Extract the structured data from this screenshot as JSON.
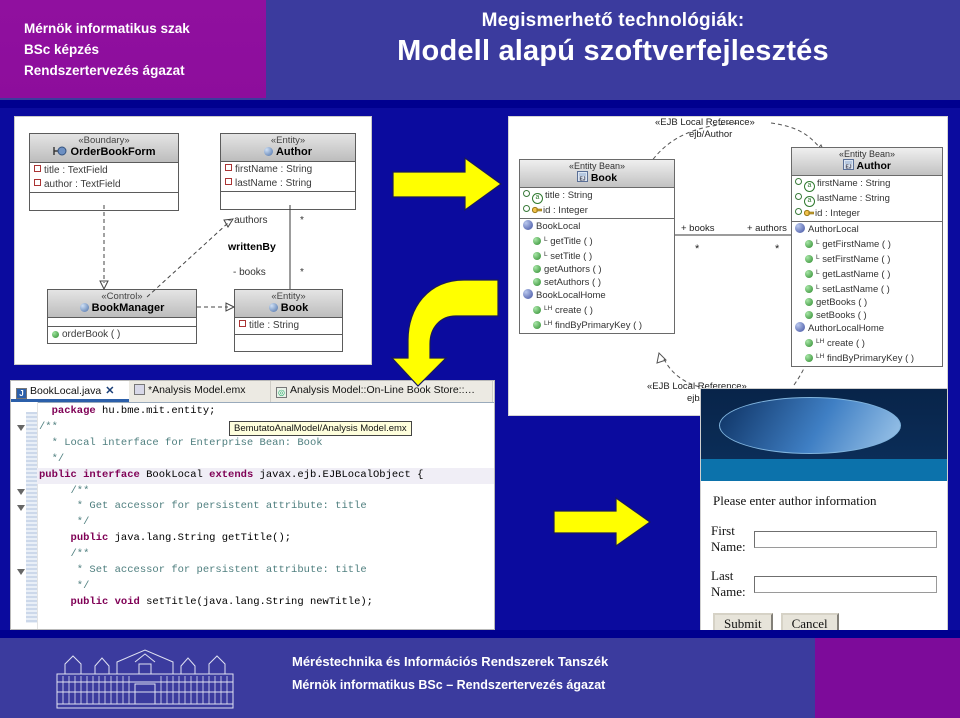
{
  "header": {
    "purple_lines": [
      "Mérnök informatikus szak",
      "BSc képzés",
      "Rendszertervezés ágazat"
    ],
    "subtitle": "Megismerhető technológiák:",
    "title": "Modell alapú szoftverfejlesztés",
    "purple_color": "#8f0f9e",
    "band_color": "#3b3b9e"
  },
  "uml_diagram": {
    "classes": [
      {
        "stereotype": "«Boundary»",
        "name": "OrderBookForm",
        "attributes": [
          "title : TextField",
          "author : TextField"
        ],
        "operations": []
      },
      {
        "stereotype": "«Entity»",
        "name": "Author",
        "attributes": [
          "firstName : String",
          "lastName : String"
        ],
        "operations": []
      },
      {
        "stereotype": "«Control»",
        "name": "BookManager",
        "attributes": [],
        "operations": [
          "orderBook ( )"
        ]
      },
      {
        "stereotype": "«Entity»",
        "name": "Book",
        "attributes": [
          "title : String"
        ],
        "operations": []
      }
    ],
    "association_name": "writtenBy",
    "role_authors": "- authors",
    "role_books": "- books",
    "mult_top": "*",
    "mult_bottom": "*"
  },
  "ejb_diagram": {
    "ref_top_stereotype": "«EJB Local Reference»",
    "ref_top_name": "ejb/Author",
    "ref_bottom_stereotype": "«EJB Local Reference»",
    "ref_bottom_name": "ejb/",
    "book": {
      "stereotype": "«Entity Bean»",
      "name": "Book",
      "attributes": [
        "title : String",
        "id : Integer"
      ],
      "local_interface": "BookLocal",
      "local_methods": [
        "getTitle ( )",
        "setTitle ( )",
        "getAuthors ( )",
        "setAuthors ( )"
      ],
      "home_interface": "BookLocalHome",
      "home_methods": [
        "create ( )",
        "findByPrimaryKey ( )"
      ]
    },
    "author": {
      "stereotype": "«Entity Bean»",
      "name": "Author",
      "attributes": [
        "firstName : String",
        "lastName : String",
        "id : Integer"
      ],
      "local_interface": "AuthorLocal",
      "local_methods": [
        "getFirstName ( )",
        "setFirstName ( )",
        "getLastName ( )",
        "setLastName ( )",
        "getBooks ( )",
        "setBooks ( )"
      ],
      "home_interface": "AuthorLocalHome",
      "home_methods": [
        "create ( )",
        "findByPrimaryKey ( )"
      ]
    },
    "role_books": "+ books",
    "role_authors": "+ authors",
    "mult_left": "*",
    "mult_right": "*"
  },
  "code_editor": {
    "tabs": [
      {
        "label": "BookLocal.java",
        "icon": "java-file-icon",
        "active": true,
        "closable": true
      },
      {
        "label": "*Analysis Model.emx",
        "icon": "emx-model-icon",
        "active": false,
        "closable": false
      },
      {
        "label": "Analysis Model::On-Line Book Store::…",
        "icon": "diagram-icon",
        "active": false,
        "closable": false
      }
    ],
    "tooltip": "BemutatoAnalModel/Analysis Model.emx",
    "lines": [
      {
        "text": "  package hu.bme.mit.entity;",
        "fold": false,
        "highlight": false
      },
      {
        "text": "/**",
        "fold": true,
        "highlight": false
      },
      {
        "text": "  * Local interface for Enterprise Bean: Book",
        "fold": false,
        "highlight": false
      },
      {
        "text": "  */",
        "fold": false,
        "highlight": false
      },
      {
        "text": "public interface BookLocal extends javax.ejb.EJBLocalObject {",
        "fold": true,
        "highlight": true
      },
      {
        "text": "     /**",
        "fold": true,
        "highlight": false
      },
      {
        "text": "      * Get accessor for persistent attribute: title",
        "fold": false,
        "highlight": false
      },
      {
        "text": "      */",
        "fold": false,
        "highlight": false
      },
      {
        "text": "     public java.lang.String getTitle();",
        "fold": false,
        "highlight": false
      },
      {
        "text": "     /**",
        "fold": true,
        "highlight": false
      },
      {
        "text": "      * Set accessor for persistent attribute: title",
        "fold": false,
        "highlight": false
      },
      {
        "text": "      */",
        "fold": false,
        "highlight": false
      },
      {
        "text": "     public void setTitle(java.lang.String newTitle);",
        "fold": false,
        "highlight": false
      }
    ]
  },
  "web_form": {
    "prompt": "Please enter author information",
    "fields": [
      {
        "label": "First Name:",
        "value": ""
      },
      {
        "label": "Last Name:",
        "value": ""
      }
    ],
    "buttons": [
      "Submit",
      "Cancel"
    ]
  },
  "arrows": [
    {
      "name": "arrow-analysis-to-design",
      "direction": "right"
    },
    {
      "name": "arrow-design-to-code",
      "direction": "curve-down"
    },
    {
      "name": "arrow-code-to-ui",
      "direction": "right"
    }
  ],
  "footer": {
    "line1": "Méréstechnika és Információs Rendszerek Tanszék",
    "line2": "Mérnök informatikus BSc – Rendszertervezés ágazat",
    "logo": "bme-building-icon"
  }
}
